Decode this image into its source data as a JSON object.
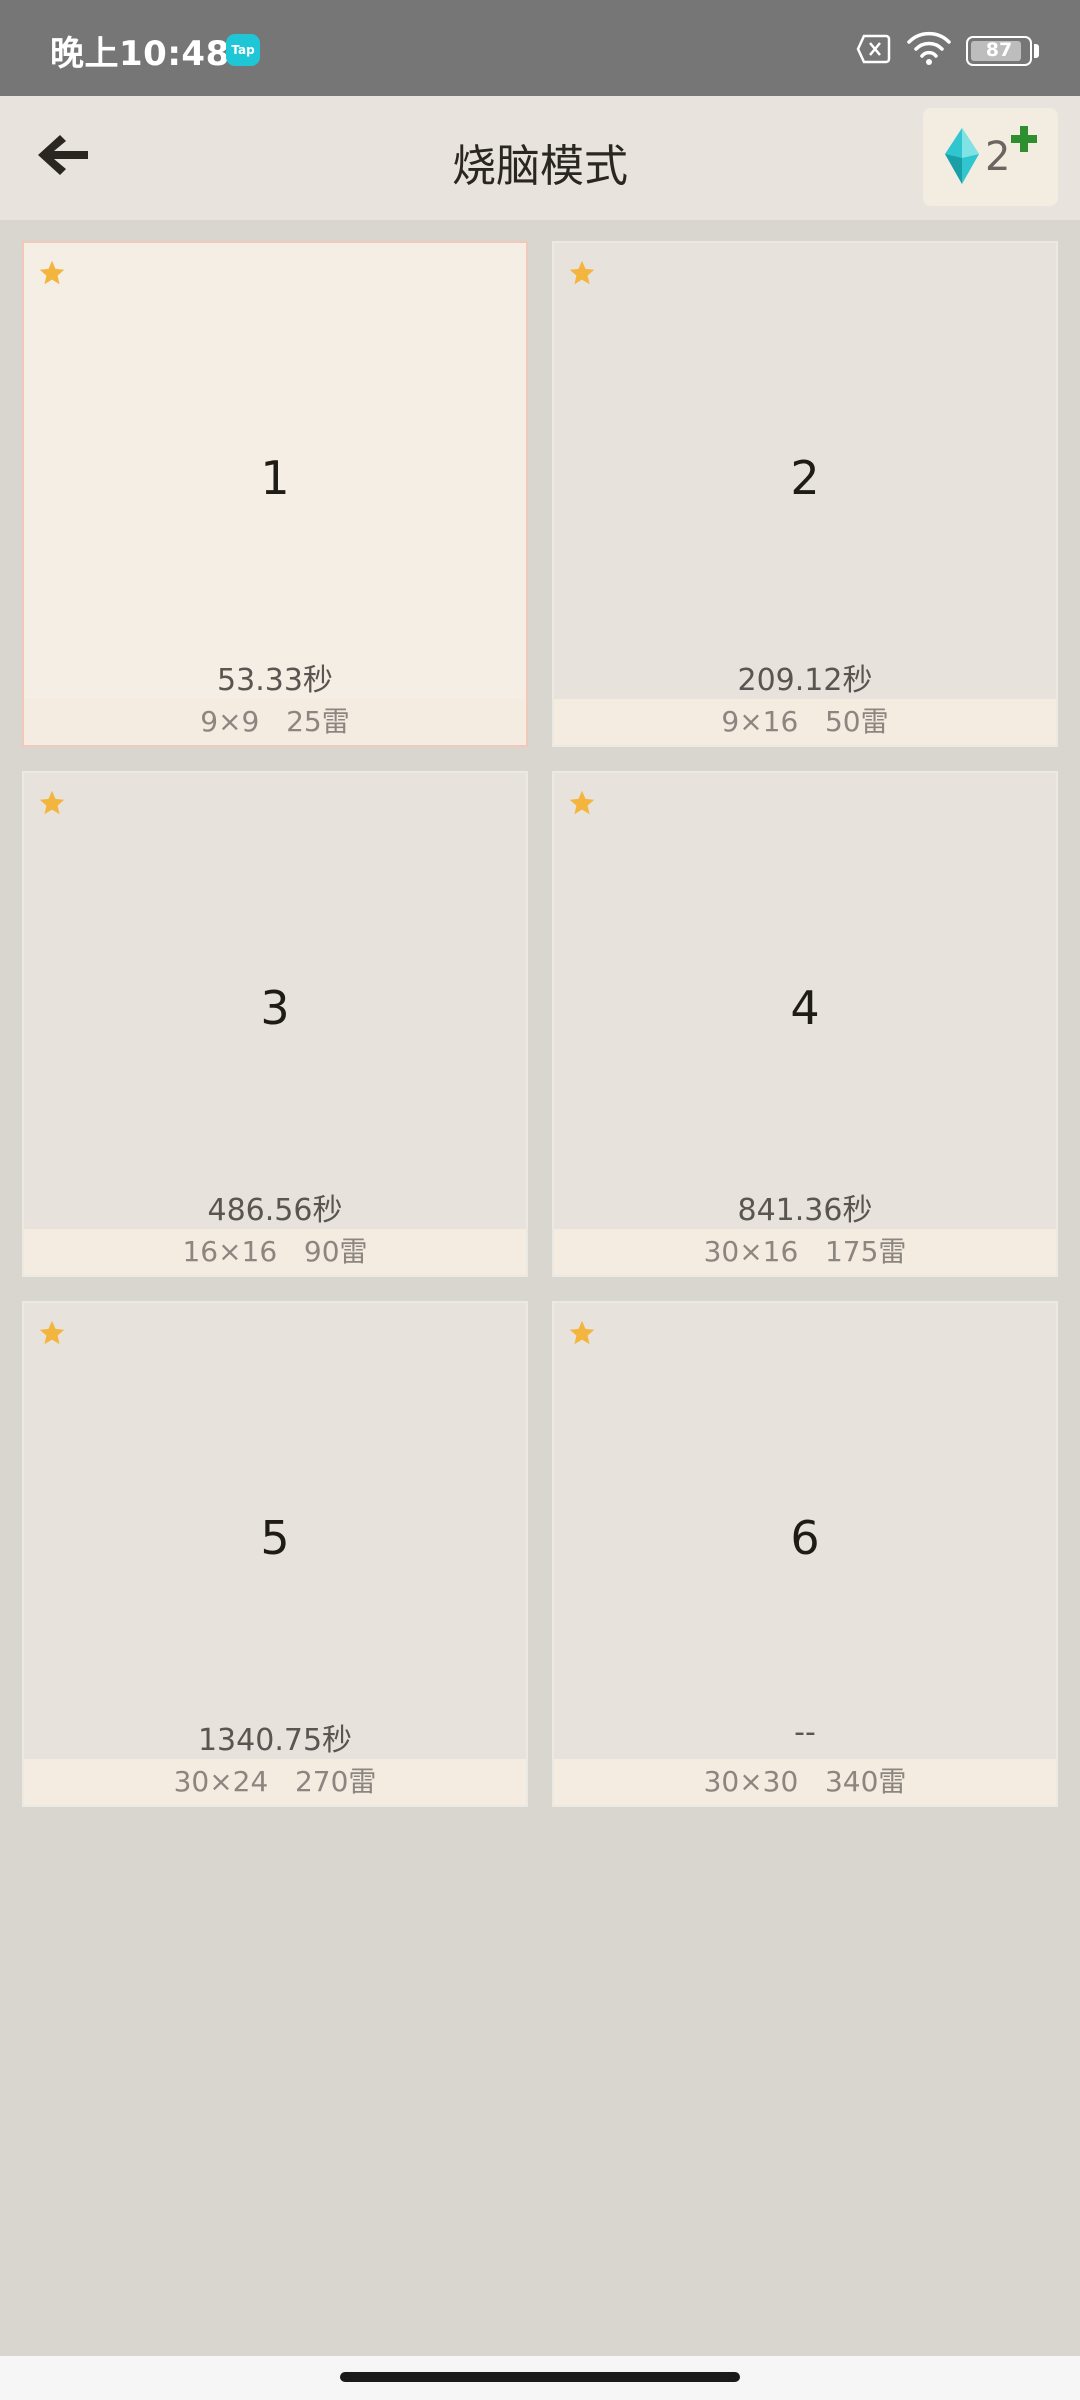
{
  "status_bar": {
    "time": "晚上10:48",
    "app_badge": "Tap",
    "battery": "87"
  },
  "header": {
    "title": "烧脑模式",
    "gem_count": "2"
  },
  "colors": {
    "star": "#f4b53f",
    "gem": "#2fc6cf",
    "plus": "#2f8f2f",
    "selected_border": "#f0c9bb"
  },
  "levels": [
    {
      "number": "1",
      "time": "53.33秒",
      "size": "9×9",
      "mines": "25雷"
    },
    {
      "number": "2",
      "time": "209.12秒",
      "size": "9×16",
      "mines": "50雷"
    },
    {
      "number": "3",
      "time": "486.56秒",
      "size": "16×16",
      "mines": "90雷"
    },
    {
      "number": "4",
      "time": "841.36秒",
      "size": "30×16",
      "mines": "175雷"
    },
    {
      "number": "5",
      "time": "1340.75秒",
      "size": "30×24",
      "mines": "270雷"
    },
    {
      "number": "6",
      "time": "--",
      "size": "30×30",
      "mines": "340雷"
    }
  ]
}
